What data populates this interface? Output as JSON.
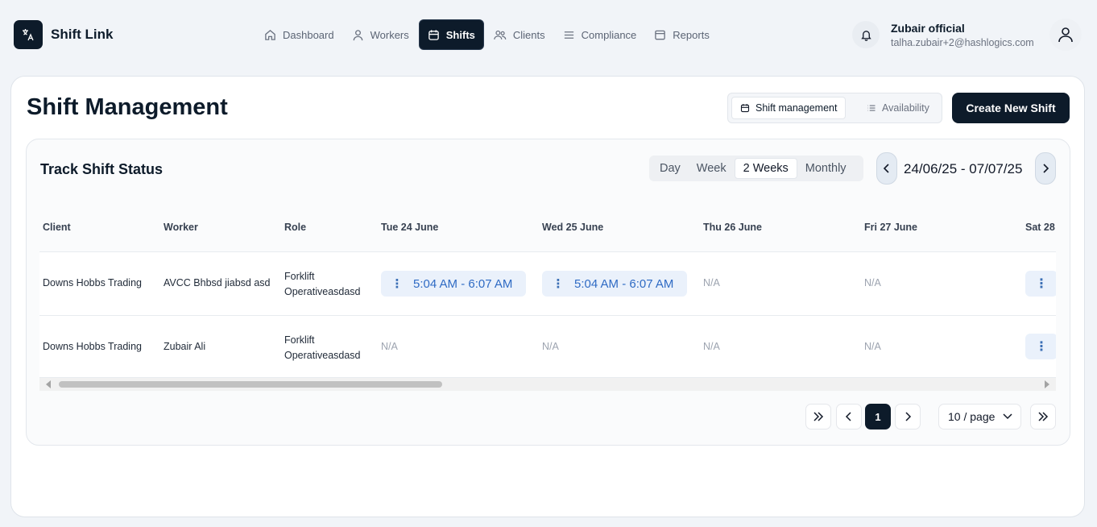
{
  "app": {
    "brand": "Shift Link",
    "nav": [
      {
        "label": "Dashboard",
        "icon": "home-icon"
      },
      {
        "label": "Workers",
        "icon": "person-icon"
      },
      {
        "label": "Shifts",
        "icon": "calendar-icon",
        "active": true
      },
      {
        "label": "Clients",
        "icon": "users-icon"
      },
      {
        "label": "Compliance",
        "icon": "menu-lines-icon"
      },
      {
        "label": "Reports",
        "icon": "report-icon"
      }
    ],
    "user": {
      "name": "Zubair official",
      "email": "talha.zubair+2@hashlogics.com"
    }
  },
  "page": {
    "title": "Shift Management",
    "view_toggle": {
      "active": "Shift management",
      "inactive": "Availability"
    },
    "create_button": "Create New Shift"
  },
  "tracker": {
    "title": "Track Shift Status",
    "range_tabs": [
      "Day",
      "Week",
      "2 Weeks",
      "Monthly"
    ],
    "active_range": "2 Weeks",
    "date_range": "24/06/25 - 07/07/25"
  },
  "table": {
    "columns": [
      "Client",
      "Worker",
      "Role",
      "Tue 24 June",
      "Wed 25 June",
      "Thu 26 June",
      "Fri 27 June",
      "Sat 28"
    ],
    "rows": [
      {
        "client": "Downs Hobbs Trading",
        "worker": "AVCC Bhbsd jiabsd asd",
        "role_line1": "Forklift",
        "role_line2": "Operativeasdasd",
        "d0": "5:04 AM - 6:07 AM",
        "d1": "5:04 AM - 6:07 AM",
        "d2": "N/A",
        "d3": "N/A"
      },
      {
        "client": "Downs Hobbs Trading",
        "worker": "Zubair Ali",
        "role_line1": "Forklift",
        "role_line2": "Operativeasdasd",
        "d0": "N/A",
        "d1": "N/A",
        "d2": "N/A",
        "d3": "N/A"
      }
    ]
  },
  "pagination": {
    "current_page": "1",
    "page_size": "10 / page"
  },
  "colors": {
    "primary": "#0d1b2a",
    "shift_pill": "#eaf1fb",
    "shift_text": "#2f6bc4"
  }
}
